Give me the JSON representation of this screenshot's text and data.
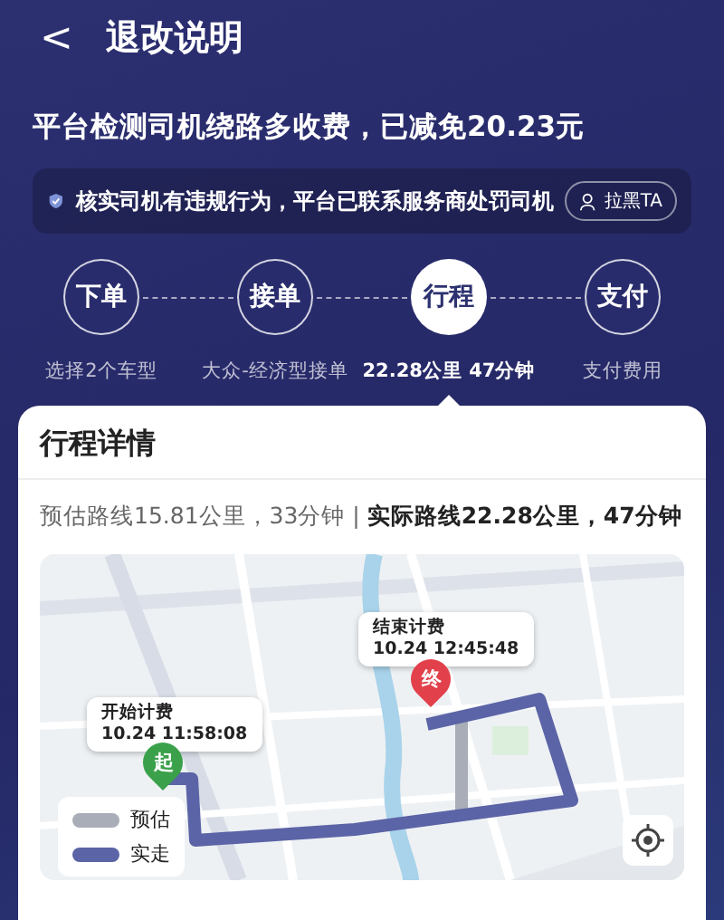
{
  "header": {
    "back": "<",
    "title": "退改说明"
  },
  "headline": "平台检测司机绕路多收费，已减免20.23元",
  "notice": {
    "text": "核实司机有违规行为，平台已联系服务商处罚司机",
    "button": "拉黑TA"
  },
  "steps": [
    {
      "label": "下单",
      "caption": "选择2个车型",
      "selected": false
    },
    {
      "label": "接单",
      "caption": "大众-经济型接单",
      "selected": false
    },
    {
      "label": "行程",
      "caption": "22.28公里 47分钟",
      "selected": true
    },
    {
      "label": "支付",
      "caption": "支付费用",
      "selected": false
    }
  ],
  "detail": {
    "title": "行程详情",
    "summary": "预估路线15.81公里，33分钟 | **实际路线22.28公里，47分钟**"
  },
  "map": {
    "kind": "picture",
    "start": {
      "marker": "起",
      "label": "开始计费",
      "time": "10.24 11:58:08"
    },
    "end": {
      "marker": "终",
      "label": "结束计费",
      "time": "10.24 12:45:48"
    },
    "legend": [
      {
        "label": "预估",
        "color": "#a9adb8"
      },
      {
        "label": "实走",
        "color": "#5b64a6"
      }
    ]
  }
}
